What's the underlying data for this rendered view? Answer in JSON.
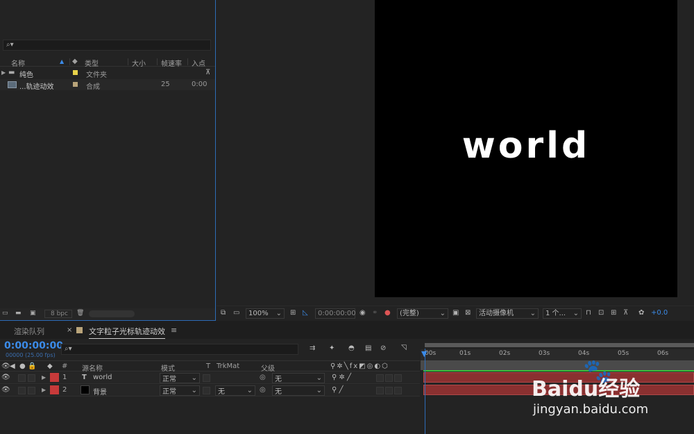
{
  "project": {
    "search_placeholder": "",
    "columns": [
      "名称",
      "类型",
      "大小",
      "帧速率",
      "入点"
    ],
    "items": [
      {
        "name": "纯色",
        "type": "文件夹",
        "fps": "",
        "in": "",
        "label_color": "#e8d24a"
      },
      {
        "name": "...轨迹动效",
        "type": "合成",
        "fps": "25",
        "in": "0:00",
        "label_color": "#b9a47a"
      }
    ],
    "bpc": "8 bpc"
  },
  "viewer": {
    "comp_text": "world",
    "zoom": "100%",
    "timecode": "0:00:00:00",
    "resolution": "(完整)",
    "camera": "活动摄像机",
    "views": "1 个...",
    "exposure": "+0.0"
  },
  "tabs": {
    "render_queue": "渲染队列",
    "comp_tab": "文字粒子光标轨迹动效"
  },
  "timeline": {
    "current_time": "0:00:00:00",
    "frame_info": "00000 (25.00 fps)",
    "columns": {
      "num": "#",
      "source_name": "源名称",
      "mode": "模式",
      "t": "T",
      "trkmat": "TrkMat",
      "parent": "父级"
    },
    "layers": [
      {
        "num": "1",
        "type_icon": "T",
        "name": "world",
        "mode": "正常",
        "trkmat": "",
        "parent": "无",
        "label_color": "#c83a3a"
      },
      {
        "num": "2",
        "type_icon": "",
        "name": "背景",
        "mode": "正常",
        "trkmat": "无",
        "parent": "无",
        "label_color": "#c83a3a"
      }
    ],
    "ruler": [
      "00s",
      "01s",
      "02s",
      "03s",
      "04s",
      "05s",
      "06s"
    ]
  },
  "watermark": {
    "brand": "Baidu经验",
    "url": "jingyan.baidu.com"
  },
  "colors": {
    "accent": "#2d6db8",
    "timecode": "#3b8be8",
    "layer_bar": "#8a3030"
  }
}
